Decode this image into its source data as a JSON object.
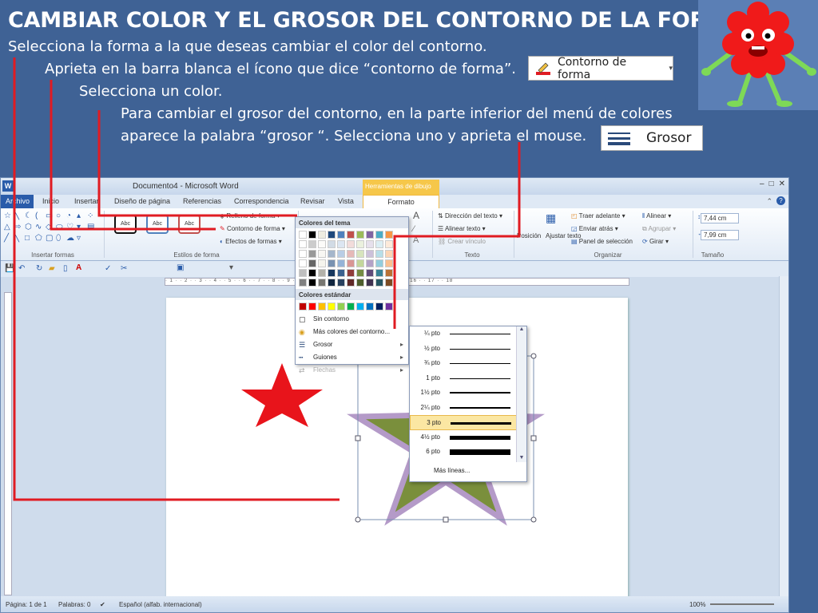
{
  "slide": {
    "title": "CAMBIAR COLOR Y EL GROSOR DEL CONTORNO DE LA FORMA",
    "step1": "Selecciona la forma a la que deseas cambiar el color del contorno.",
    "step2": "Aprieta en la barra blanca el ícono que dice “contorno de forma”.",
    "step3": "Selecciona un color.",
    "step4_line1": "Para cambiar el grosor del contorno, en la parte inferior del menú de colores",
    "step4_line2": "aparece la palabra “grosor “.   Selecciona uno y aprieta el mouse.",
    "callout_contorno": "Contorno de forma",
    "callout_grosor": "Grosor"
  },
  "window": {
    "title": "Documento4 - Microsoft Word",
    "word_logo": "W",
    "contextual_tab": "Herramientas de dibujo",
    "win_buttons": [
      "–",
      "□",
      "✕"
    ]
  },
  "tabs": {
    "archivo": "Archivo",
    "inicio": "Inicio",
    "insertar": "Insertar",
    "diseno": "Diseño de página",
    "referencias": "Referencias",
    "correspondencia": "Correspondencia",
    "revisar": "Revisar",
    "vista": "Vista",
    "formato": "Formato"
  },
  "ribbon": {
    "insert_shapes_label": "Insertar formas",
    "shape_styles_label": "Estilos de forma",
    "text_label": "Texto",
    "arrange_label": "Organizar",
    "size_label": "Tamaño",
    "style_sample": "Abc",
    "fill": "Relleno de forma",
    "outline": "Contorno de forma",
    "effects": "Efectos de formas",
    "text_direction": "Dirección del texto",
    "align_text": "Alinear texto",
    "create_link": "Crear vínculo",
    "position": "Posición",
    "wrap_text": "Ajustar texto",
    "bring_forward": "Traer adelante",
    "send_backward": "Enviar atrás",
    "selection_pane": "Panel de selección",
    "align": "Alinear",
    "group": "Agrupar",
    "rotate": "Girar",
    "height": "7,44 cm",
    "width": "7,99 cm"
  },
  "color_menu": {
    "theme_colors": "Colores del tema",
    "standard_colors": "Colores estándar",
    "no_outline": "Sin contorno",
    "more_colors": "Más colores del contorno...",
    "weight": "Grosor",
    "dashes": "Guiones",
    "arrows": "Flechas"
  },
  "weight_menu": {
    "items": [
      {
        "label": "¼ pto",
        "weight": 0.25
      },
      {
        "label": "½ pto",
        "weight": 0.5
      },
      {
        "label": "¾ pto",
        "weight": 0.75
      },
      {
        "label": "1 pto",
        "weight": 1
      },
      {
        "label": "1½ pto",
        "weight": 1.5
      },
      {
        "label": "2¼ pto",
        "weight": 2.25
      },
      {
        "label": "3 pto",
        "weight": 3
      },
      {
        "label": "4½ pto",
        "weight": 4.5
      },
      {
        "label": "6 pto",
        "weight": 6
      }
    ],
    "selected_index": 6,
    "more_lines": "Más líneas..."
  },
  "status": {
    "page": "Página: 1 de 1",
    "words": "Palabras: 0",
    "language": "Español (alfab. internacional)",
    "zoom": "100%"
  },
  "colors": {
    "slide_bg": "#3f6295",
    "red_star": "#e8141b",
    "green_star_fill": "#7a8f3c",
    "star_outline": "#b49ac8",
    "pointer_lines": "#e01b22"
  }
}
